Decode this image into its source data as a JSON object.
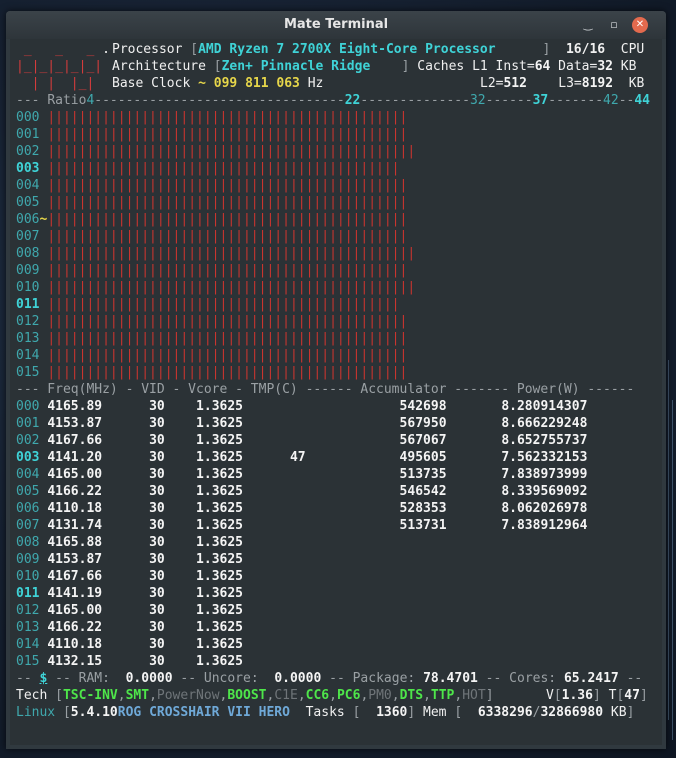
{
  "window": {
    "title": "Mate Terminal"
  },
  "processor": {
    "label": "Processor",
    "name": "AMD Ryzen 7 2700X Eight-Core Processor",
    "threads": "16/16",
    "threads_label": "CPU",
    "arch_label": "Architecture",
    "arch": "Zen+ Pinnacle Ridge",
    "caches_label": "Caches",
    "l1_inst_label": "L1 Inst=",
    "l1_inst": "64",
    "l1_data_label": "Data=",
    "l1_data": "32",
    "kb": "KB",
    "l2_label": "L2=",
    "l2": "512",
    "l3_label": "L3=",
    "l3": "8192",
    "base_clock_label": "Base Clock",
    "base_clock": "~ 099 811 063",
    "hz": "Hz"
  },
  "ratio_header": {
    "label": "Ratio",
    "marks": [
      "4",
      "22",
      "32",
      "37",
      "42",
      "44"
    ]
  },
  "ratio_rows": [
    {
      "id": "000",
      "bold": false,
      "bars": 46
    },
    {
      "id": "001",
      "bold": false,
      "bars": 46
    },
    {
      "id": "002",
      "bold": false,
      "bars": 47
    },
    {
      "id": "003",
      "bold": true,
      "bars": 45
    },
    {
      "id": "004",
      "bold": false,
      "bars": 46
    },
    {
      "id": "005",
      "bold": false,
      "bars": 46
    },
    {
      "id": "006~",
      "bold": false,
      "bars": 46
    },
    {
      "id": "007",
      "bold": false,
      "bars": 46
    },
    {
      "id": "008",
      "bold": false,
      "bars": 47
    },
    {
      "id": "009",
      "bold": false,
      "bars": 46
    },
    {
      "id": "010",
      "bold": false,
      "bars": 47
    },
    {
      "id": "011",
      "bold": true,
      "bars": 45
    },
    {
      "id": "012",
      "bold": false,
      "bars": 46
    },
    {
      "id": "013",
      "bold": false,
      "bars": 46
    },
    {
      "id": "014",
      "bold": false,
      "bars": 46
    },
    {
      "id": "015",
      "bold": false,
      "bars": 46
    }
  ],
  "freq_header": "--- Freq(MHz) - VID - Vcore - TMP(C) ------ Accumulator ------- Power(W) ------",
  "freq_rows": [
    {
      "id": "000",
      "bold": false,
      "freq": "4165.89",
      "vid": "30",
      "vcore": "1.3625",
      "tmp": "",
      "acc": "542698",
      "power": "8.280914307"
    },
    {
      "id": "001",
      "bold": false,
      "freq": "4153.87",
      "vid": "30",
      "vcore": "1.3625",
      "tmp": "",
      "acc": "567950",
      "power": "8.666229248"
    },
    {
      "id": "002",
      "bold": false,
      "freq": "4167.66",
      "vid": "30",
      "vcore": "1.3625",
      "tmp": "",
      "acc": "567067",
      "power": "8.652755737"
    },
    {
      "id": "003",
      "bold": true,
      "freq": "4141.20",
      "vid": "30",
      "vcore": "1.3625",
      "tmp": "47",
      "acc": "495605",
      "power": "7.562332153"
    },
    {
      "id": "004",
      "bold": false,
      "freq": "4165.00",
      "vid": "30",
      "vcore": "1.3625",
      "tmp": "",
      "acc": "513735",
      "power": "7.838973999"
    },
    {
      "id": "005",
      "bold": false,
      "freq": "4166.22",
      "vid": "30",
      "vcore": "1.3625",
      "tmp": "",
      "acc": "546542",
      "power": "8.339569092"
    },
    {
      "id": "006",
      "bold": false,
      "freq": "4110.18",
      "vid": "30",
      "vcore": "1.3625",
      "tmp": "",
      "acc": "528353",
      "power": "8.062026978"
    },
    {
      "id": "007",
      "bold": false,
      "freq": "4131.74",
      "vid": "30",
      "vcore": "1.3625",
      "tmp": "",
      "acc": "513731",
      "power": "7.838912964"
    },
    {
      "id": "008",
      "bold": false,
      "freq": "4165.88",
      "vid": "30",
      "vcore": "1.3625",
      "tmp": "",
      "acc": "",
      "power": ""
    },
    {
      "id": "009",
      "bold": false,
      "freq": "4153.87",
      "vid": "30",
      "vcore": "1.3625",
      "tmp": "",
      "acc": "",
      "power": ""
    },
    {
      "id": "010",
      "bold": false,
      "freq": "4167.66",
      "vid": "30",
      "vcore": "1.3625",
      "tmp": "",
      "acc": "",
      "power": ""
    },
    {
      "id": "011",
      "bold": true,
      "freq": "4141.19",
      "vid": "30",
      "vcore": "1.3625",
      "tmp": "",
      "acc": "",
      "power": ""
    },
    {
      "id": "012",
      "bold": false,
      "freq": "4165.00",
      "vid": "30",
      "vcore": "1.3625",
      "tmp": "",
      "acc": "",
      "power": ""
    },
    {
      "id": "013",
      "bold": false,
      "freq": "4166.22",
      "vid": "30",
      "vcore": "1.3625",
      "tmp": "",
      "acc": "",
      "power": ""
    },
    {
      "id": "014",
      "bold": false,
      "freq": "4110.18",
      "vid": "30",
      "vcore": "1.3625",
      "tmp": "",
      "acc": "",
      "power": ""
    },
    {
      "id": "015",
      "bold": false,
      "freq": "4132.15",
      "vid": "30",
      "vcore": "1.3625",
      "tmp": "",
      "acc": "",
      "power": ""
    }
  ],
  "summary": {
    "dollar": "$",
    "ram_label": "RAM:",
    "ram": "0.0000",
    "uncore_label": "Uncore:",
    "uncore": "0.0000",
    "package_label": "Package:",
    "package": "78.4701",
    "cores_label": "Cores:",
    "cores": "65.2417"
  },
  "tech": {
    "label": "Tech",
    "flags": [
      {
        "name": "TSC-INV",
        "on": true
      },
      {
        "name": "SMT",
        "on": true
      },
      {
        "name": "PowerNow",
        "on": false
      },
      {
        "name": "BOOST",
        "on": true
      },
      {
        "name": "C1E",
        "on": false
      },
      {
        "name": "CC6",
        "on": true
      },
      {
        "name": "PC6",
        "on": true
      },
      {
        "name": "PM0",
        "on": false
      },
      {
        "name": "DTS",
        "on": true
      },
      {
        "name": "TTP",
        "on": true
      },
      {
        "name": "HOT",
        "on": false
      }
    ],
    "v_label": "V",
    "v": "1.36",
    "t_label": "T",
    "t": "47"
  },
  "status": {
    "os": "Linux",
    "kernel": "5.4.10",
    "board": "ROG CROSSHAIR VII HERO",
    "tasks_label": "Tasks",
    "tasks": "1360",
    "mem_label": "Mem",
    "mem_used": "6338296",
    "mem_total": "32866980",
    "mem_unit": "KB"
  },
  "colors": {
    "bar": "#c9352f",
    "accent": "#3fd3d7",
    "green": "#4ee64a",
    "yellow": "#e6d64a"
  }
}
